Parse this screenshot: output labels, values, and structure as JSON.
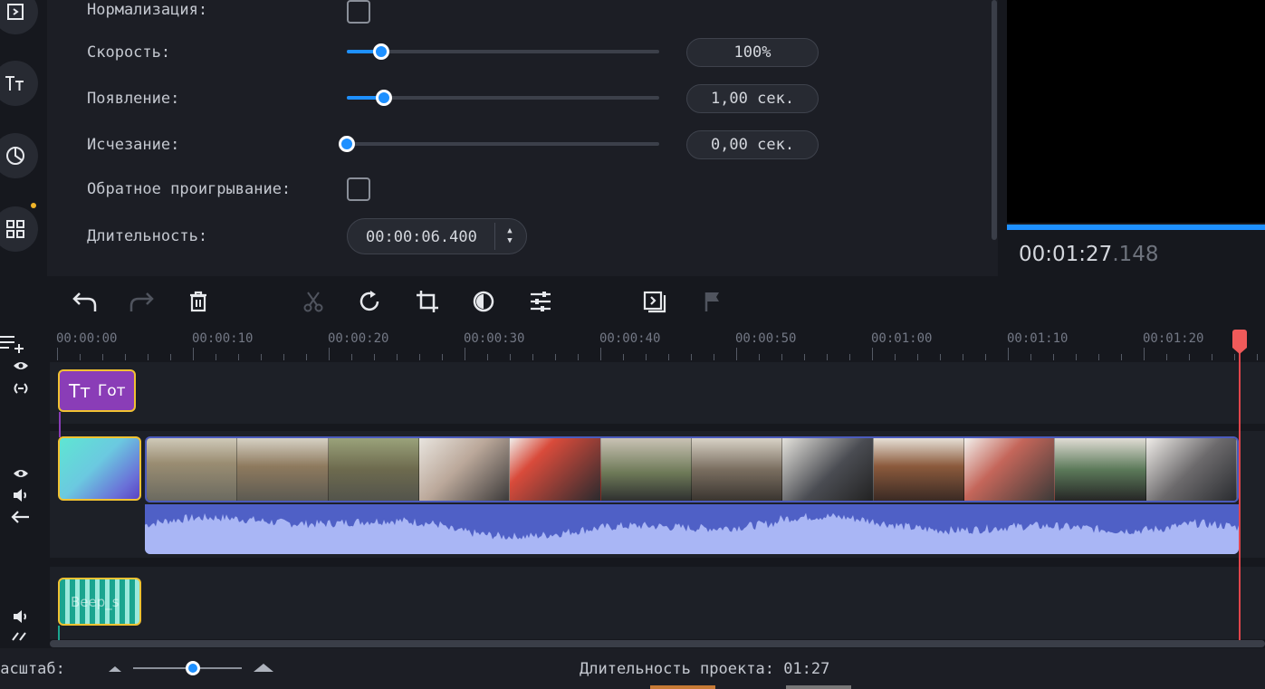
{
  "properties": {
    "normalization_label": "Нормализация:",
    "speed": {
      "label": "Скорость:",
      "value_text": "100%",
      "slider_level": 0.11
    },
    "fade_in": {
      "label": "Появление:",
      "value_text": "1,00 сек.",
      "slider_level": 0.12
    },
    "fade_out": {
      "label": "Исчезание:",
      "value_text": "0,00 сек.",
      "slider_level": 0.0
    },
    "reverse_label": "Обратное проигрывание:",
    "duration": {
      "label": "Длительность:",
      "value": "00:00:06.400"
    }
  },
  "preview": {
    "timecode_main": "00:01:27",
    "timecode_ms": ".148",
    "progress": 1.0
  },
  "toolbar": {
    "buttons": [
      "undo-icon",
      "redo-icon",
      "delete-icon",
      "cut-icon",
      "rotate-icon",
      "crop-icon",
      "color-adjust-icon",
      "equalizer-icon",
      "insert-icon",
      "marker-flag-icon"
    ]
  },
  "timeline": {
    "ruler_labels": [
      "00:00:00",
      "00:00:10",
      "00:00:20",
      "00:00:30",
      "00:00:40",
      "00:00:50",
      "00:01:00",
      "00:01:10",
      "00:01:20"
    ],
    "title_clip_text": "Гот",
    "music_clip_text": "Beep_s",
    "playhead_time": "00:01:27.148"
  },
  "status": {
    "zoom_label": "Масштаб:",
    "zoom_level": 0.55,
    "project_duration_label": "Длительность проекта:",
    "project_duration_value": "01:27"
  },
  "colors": {
    "accent": "#1e90ff",
    "title_clip": "#8a3db7",
    "selection": "#f1c232",
    "video_clip_border": "#4b5bbd",
    "audio_wave": "#a9b6f5",
    "playhead": "#e0454b"
  }
}
